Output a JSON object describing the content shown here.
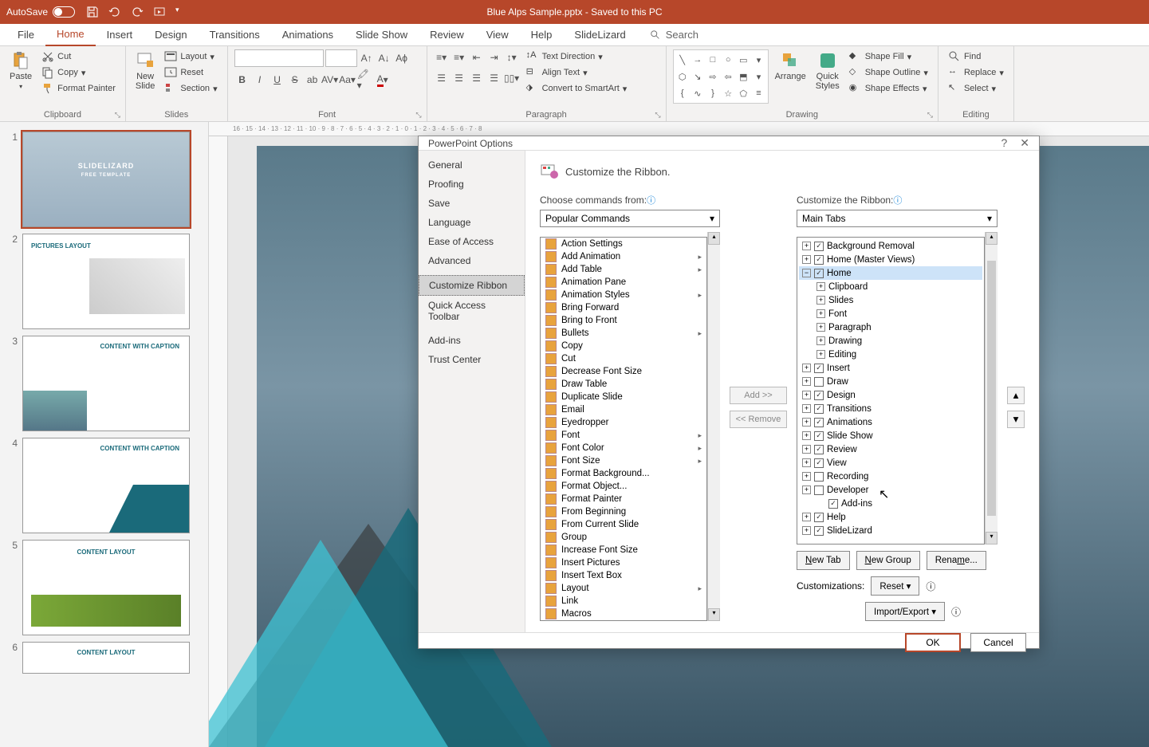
{
  "title_bar": {
    "autosave": "AutoSave",
    "doc_title": "Blue Alps Sample.pptx - Saved to this PC"
  },
  "ribbon_tabs": [
    "File",
    "Home",
    "Insert",
    "Design",
    "Transitions",
    "Animations",
    "Slide Show",
    "Review",
    "View",
    "Help",
    "SlideLizard"
  ],
  "active_tab": "Home",
  "search_label": "Search",
  "ribbon": {
    "groups": {
      "clipboard": {
        "label": "Clipboard",
        "paste": "Paste",
        "cut": "Cut",
        "copy": "Copy",
        "format_painter": "Format Painter"
      },
      "slides": {
        "label": "Slides",
        "new_slide": "New\nSlide",
        "layout": "Layout",
        "reset": "Reset",
        "section": "Section"
      },
      "font": {
        "label": "Font"
      },
      "paragraph": {
        "label": "Paragraph",
        "text_dir": "Text Direction",
        "align": "Align Text",
        "smartart": "Convert to SmartArt"
      },
      "drawing": {
        "label": "Drawing",
        "arrange": "Arrange",
        "quick_styles": "Quick\nStyles",
        "shape_fill": "Shape Fill",
        "shape_outline": "Shape Outline",
        "shape_effects": "Shape Effects"
      },
      "editing": {
        "label": "Editing",
        "find": "Find",
        "replace": "Replace",
        "select": "Select"
      }
    }
  },
  "slides": [
    {
      "n": "1",
      "title": "SLIDELIZARD",
      "sub": "FREE TEMPLATE",
      "type": "cover"
    },
    {
      "n": "2",
      "title": "PICTURES LAYOUT",
      "type": "pictures"
    },
    {
      "n": "3",
      "title": "CONTENT WITH CAPTION",
      "type": "content"
    },
    {
      "n": "4",
      "title": "CONTENT WITH CAPTION",
      "type": "content"
    },
    {
      "n": "5",
      "title": "CONTENT LAYOUT",
      "type": "green"
    },
    {
      "n": "6",
      "title": "CONTENT LAYOUT",
      "type": "green"
    }
  ],
  "dialog": {
    "title": "PowerPoint Options",
    "nav": [
      "General",
      "Proofing",
      "Save",
      "Language",
      "Ease of Access",
      "Advanced",
      "Customize Ribbon",
      "Quick Access Toolbar",
      "Add-ins",
      "Trust Center"
    ],
    "nav_active": "Customize Ribbon",
    "heading": "Customize the Ribbon.",
    "choose_label": "Choose commands from:",
    "choose_value": "Popular Commands",
    "customize_label": "Customize the Ribbon:",
    "customize_value": "Main Tabs",
    "commands": [
      {
        "label": "Action Settings",
        "icon": "action"
      },
      {
        "label": "Add Animation",
        "icon": "anim",
        "sub": true
      },
      {
        "label": "Add Table",
        "icon": "table",
        "sub": true
      },
      {
        "label": "Animation Pane",
        "icon": "pane"
      },
      {
        "label": "Animation Styles",
        "icon": "anim",
        "sub": true
      },
      {
        "label": "Bring Forward",
        "icon": "forward"
      },
      {
        "label": "Bring to Front",
        "icon": "front"
      },
      {
        "label": "Bullets",
        "icon": "bullets",
        "sub": true
      },
      {
        "label": "Copy",
        "icon": "copy"
      },
      {
        "label": "Cut",
        "icon": "cut"
      },
      {
        "label": "Decrease Font Size",
        "icon": "fontdown"
      },
      {
        "label": "Draw Table",
        "icon": "drawtable"
      },
      {
        "label": "Duplicate Slide",
        "icon": "dup"
      },
      {
        "label": "Email",
        "icon": "email"
      },
      {
        "label": "Eyedropper",
        "icon": "eye"
      },
      {
        "label": "Font",
        "icon": "font",
        "sub": true
      },
      {
        "label": "Font Color",
        "icon": "fontcolor",
        "sub": true
      },
      {
        "label": "Font Size",
        "icon": "fontsize",
        "sub": true
      },
      {
        "label": "Format Background...",
        "icon": "bg"
      },
      {
        "label": "Format Object...",
        "icon": "obj"
      },
      {
        "label": "Format Painter",
        "icon": "painter"
      },
      {
        "label": "From Beginning",
        "icon": "begin"
      },
      {
        "label": "From Current Slide",
        "icon": "current"
      },
      {
        "label": "Group",
        "icon": "group"
      },
      {
        "label": "Increase Font Size",
        "icon": "fontup"
      },
      {
        "label": "Insert Pictures",
        "icon": "pic"
      },
      {
        "label": "Insert Text Box",
        "icon": "textbox"
      },
      {
        "label": "Layout",
        "icon": "layout",
        "sub": true
      },
      {
        "label": "Link",
        "icon": "link"
      },
      {
        "label": "Macros",
        "icon": "macro"
      }
    ],
    "tree": [
      {
        "label": "Background Removal",
        "checked": true,
        "exp": "+",
        "lvl": 0
      },
      {
        "label": "Home (Master Views)",
        "checked": true,
        "exp": "+",
        "lvl": 0
      },
      {
        "label": "Home",
        "checked": true,
        "exp": "−",
        "lvl": 0,
        "selected": true
      },
      {
        "label": "Clipboard",
        "exp": "+",
        "lvl": 1
      },
      {
        "label": "Slides",
        "exp": "+",
        "lvl": 1
      },
      {
        "label": "Font",
        "exp": "+",
        "lvl": 1
      },
      {
        "label": "Paragraph",
        "exp": "+",
        "lvl": 1
      },
      {
        "label": "Drawing",
        "exp": "+",
        "lvl": 1
      },
      {
        "label": "Editing",
        "exp": "+",
        "lvl": 1
      },
      {
        "label": "Insert",
        "checked": true,
        "exp": "+",
        "lvl": 0
      },
      {
        "label": "Draw",
        "checked": false,
        "exp": "+",
        "lvl": 0
      },
      {
        "label": "Design",
        "checked": true,
        "exp": "+",
        "lvl": 0
      },
      {
        "label": "Transitions",
        "checked": true,
        "exp": "+",
        "lvl": 0
      },
      {
        "label": "Animations",
        "checked": true,
        "exp": "+",
        "lvl": 0
      },
      {
        "label": "Slide Show",
        "checked": true,
        "exp": "+",
        "lvl": 0
      },
      {
        "label": "Review",
        "checked": true,
        "exp": "+",
        "lvl": 0
      },
      {
        "label": "View",
        "checked": true,
        "exp": "+",
        "lvl": 0
      },
      {
        "label": "Recording",
        "checked": false,
        "exp": "+",
        "lvl": 0
      },
      {
        "label": "Developer",
        "checked": false,
        "exp": "+",
        "lvl": 0
      },
      {
        "label": "Add-ins",
        "checked": true,
        "exp": "",
        "lvl": 1
      },
      {
        "label": "Help",
        "checked": true,
        "exp": "+",
        "lvl": 0
      },
      {
        "label": "SlideLizard",
        "checked": true,
        "exp": "+",
        "lvl": 0
      }
    ],
    "add_btn": "Add >>",
    "remove_btn": "<< Remove",
    "new_tab": "New Tab",
    "new_group": "New Group",
    "rename": "Rename...",
    "customizations": "Customizations:",
    "reset": "Reset",
    "import_export": "Import/Export",
    "ok": "OK",
    "cancel": "Cancel"
  }
}
